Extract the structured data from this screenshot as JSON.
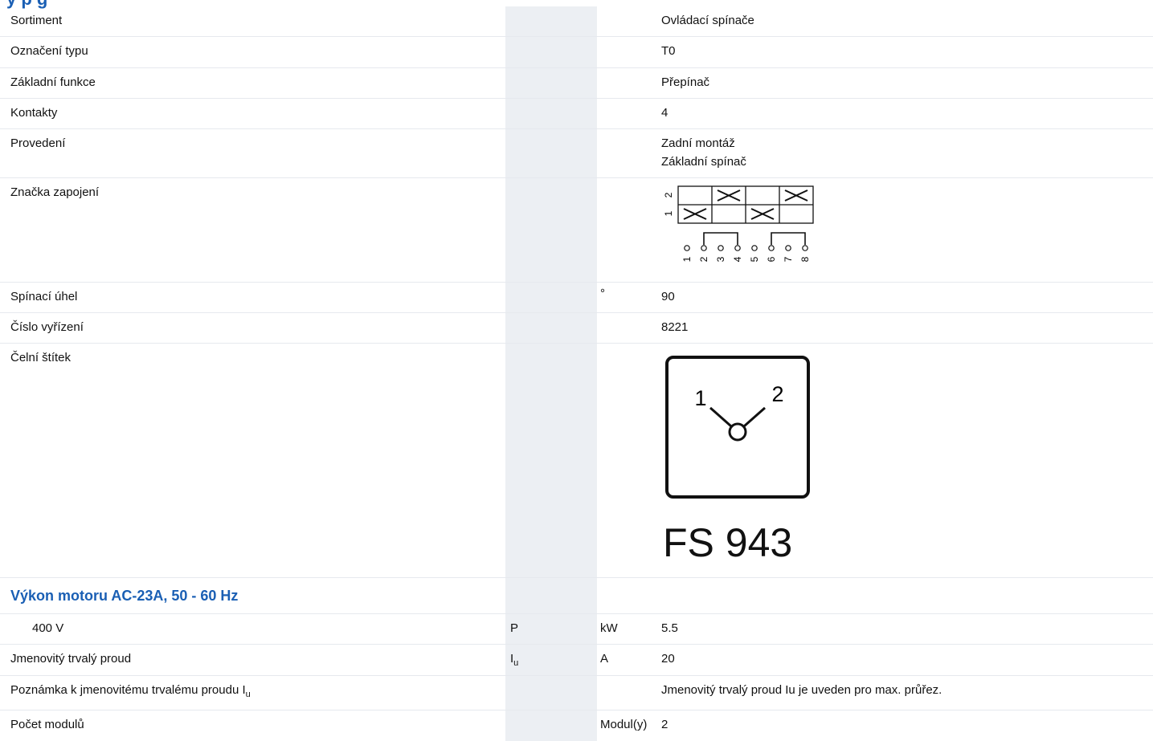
{
  "header": {
    "title_fragment": "y p g"
  },
  "rows": {
    "sortiment": {
      "label": "Sortiment",
      "value": "Ovládací spínače"
    },
    "typ": {
      "label": "Označení typu",
      "value": "T0"
    },
    "funkce": {
      "label": "Základní funkce",
      "value": "Přepínač"
    },
    "kontakty": {
      "label": "Kontakty",
      "value": "4"
    },
    "provedeni": {
      "label": "Provedení",
      "value_line1": "Zadní montáž",
      "value_line2": "Základní spínač"
    },
    "znacka": {
      "label": "Značka zapojení"
    },
    "uhel": {
      "label": "Spínací úhel",
      "unit": "°",
      "value": "90"
    },
    "cislo": {
      "label": "Číslo vyřízení",
      "value": "8221"
    },
    "stitek": {
      "label": "Čelní štítek",
      "plate_left": "1",
      "plate_right": "2",
      "plate_code": "FS 943"
    },
    "vykon": {
      "section_title": "Výkon motoru AC-23A, 50 - 60 Hz"
    },
    "v400": {
      "label": "400 V",
      "symbol": "P",
      "unit": "kW",
      "value": "5.5"
    },
    "proud": {
      "label": "Jmenovitý trvalý proud",
      "symbol_main": "I",
      "symbol_sub": "u",
      "unit": "A",
      "value": "20"
    },
    "poznamka": {
      "label_main": "Poznámka k jmenovitému trvalému proudu I",
      "label_sub": "u",
      "value": "Jmenovitý trvalý proud Iu je uveden pro max. průřez."
    },
    "moduly": {
      "label": "Počet modulů",
      "unit": "Modul(y)",
      "value": "2"
    }
  },
  "diagram": {
    "row_labels": [
      "2",
      "1"
    ],
    "terminals": [
      "1",
      "2",
      "3",
      "4",
      "5",
      "6",
      "7",
      "8"
    ]
  }
}
